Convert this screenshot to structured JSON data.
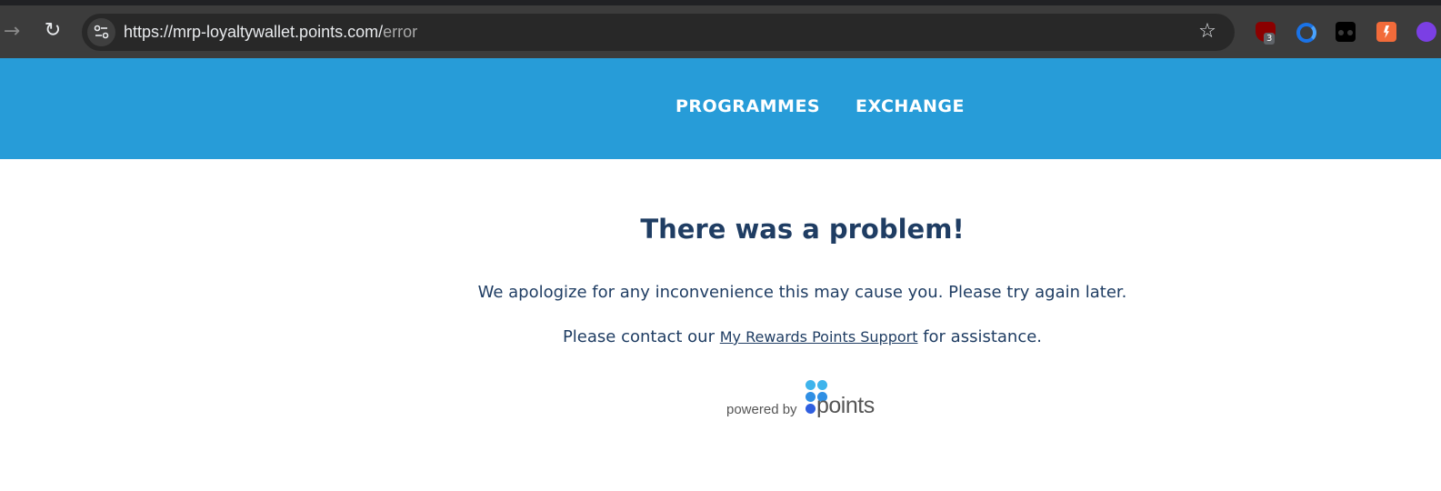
{
  "browser": {
    "url_host": "https://mrp-loyaltywallet.points.com/",
    "url_path": "error",
    "extension_badge": "3"
  },
  "nav": {
    "programmes": "PROGRAMMES",
    "exchange": "EXCHANGE"
  },
  "error": {
    "title": "There was a problem!",
    "message": "We apologize for any inconvenience this may cause you. Please try again later.",
    "contact_prefix": "Please contact our ",
    "contact_link": "My Rewards Points Support",
    "contact_suffix": " for assistance."
  },
  "footer": {
    "powered_by": "powered by",
    "brand": "points"
  },
  "colors": {
    "header_bg": "#279cd8",
    "text_navy": "#1f3d63",
    "logo_blue": "#2f6fe0",
    "logo_light_blue": "#3fb4ec"
  },
  "icons": [
    "forward-arrow-icon",
    "reload-icon",
    "site-info-icon",
    "bookmark-star-icon",
    "ublock-icon",
    "blue-circle-extension-icon",
    "black-extension-icon",
    "orange-extension-icon",
    "purple-extension-icon",
    "points-logo-icon"
  ]
}
